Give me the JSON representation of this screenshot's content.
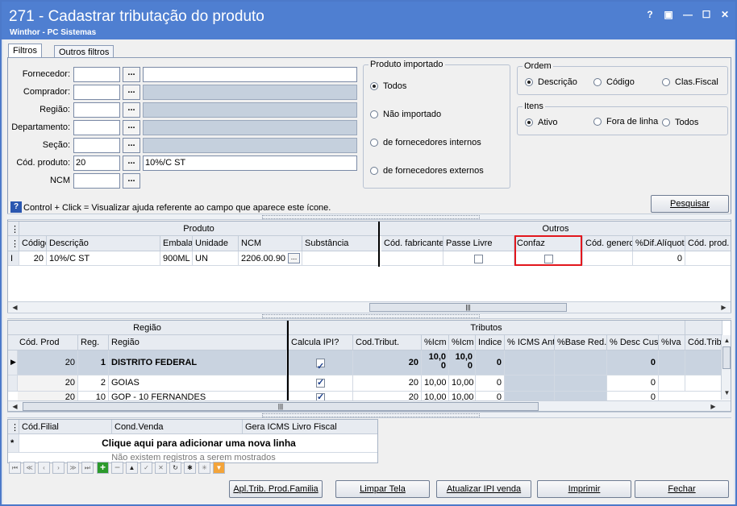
{
  "window": {
    "title": "271 - Cadastrar tributação do produto",
    "subtitle": "Winthor - PC Sistemas",
    "controls": [
      "?",
      "▣",
      "—",
      "☐",
      "✕"
    ]
  },
  "tabs": [
    {
      "label": "Filtros",
      "active": true
    },
    {
      "label": "Outros filtros",
      "active": false
    }
  ],
  "filters": {
    "fornecedor_label": "Fornecedor:",
    "comprador_label": "Comprador:",
    "regiao_label": "Região:",
    "departamento_label": "Departamento:",
    "secao_label": "Seção:",
    "cod_produto_label": "Cód. produto:",
    "cod_produto_value": "20",
    "cod_produto_desc": "10%/C ST",
    "ncm_label": "NCM",
    "dots": "..."
  },
  "produto_importado": {
    "title": "Produto importado",
    "options": [
      "Todos",
      "Não importado",
      "de fornecedores internos",
      "de fornecedores externos"
    ],
    "selected": 0
  },
  "ordem": {
    "title": "Ordem",
    "options": [
      "Descrição",
      "Código",
      "Clas.Fiscal"
    ],
    "selected": 0
  },
  "itens": {
    "title": "Itens",
    "options": [
      "Ativo",
      "Fora de linha",
      "Todos"
    ],
    "selected": 0
  },
  "help_text": "Control + Click = Visualizar ajuda referente ao campo que aparece este ícone.",
  "pesquisar_label": "Pesquisar",
  "grid1": {
    "group_produto": "Produto",
    "group_outros": "Outros",
    "columns": [
      "Código",
      "Descrição",
      "Embalag",
      "Unidade",
      "NCM",
      "Substância",
      "Cód. fabricante",
      "Passe Livre",
      "Confaz",
      "Cód. generc",
      "%Dif.Alíquot",
      "Cód. prod. n"
    ],
    "row": {
      "indicator": "I",
      "codigo": "20",
      "descricao": "10%/C ST",
      "embalagem": "900ML",
      "unidade": "UN",
      "ncm": "2206.00.90",
      "ncm_btn": "...",
      "dif_aliquota": "0"
    }
  },
  "grid2": {
    "group_regiao": "Região",
    "group_tributos": "Tributos",
    "columns": [
      "Cód. Prod",
      "Reg.",
      "Região",
      "Calcula IPI?",
      "Cod.Tribut.",
      "%Icm",
      "%Icm",
      "Indice",
      "% ICMS Ant",
      "%Base Red.",
      "% Desc Cus",
      "%Iva",
      "Cód.Trib"
    ],
    "rows": [
      {
        "cod": "20",
        "reg": "1",
        "regiao": "DISTRITO FEDERAL",
        "ipi": true,
        "trib": "20",
        "icm1": "10,0\n0",
        "icm2": "10,0\n0",
        "indice": "0",
        "desc": "0",
        "selected": true
      },
      {
        "cod": "20",
        "reg": "2",
        "regiao": "GOIAS",
        "ipi": true,
        "trib": "20",
        "icm1": "10,00",
        "icm2": "10,00",
        "indice": "0",
        "desc": "0",
        "selected": false
      },
      {
        "cod": "20",
        "reg": "10",
        "regiao": "GOP - 10 FERNANDES",
        "ipi": true,
        "trib": "20",
        "icm1": "10,00",
        "icm2": "10,00",
        "indice": "0",
        "desc": "0",
        "selected": false
      }
    ]
  },
  "grid3": {
    "columns": [
      "Cód.Filial",
      "Cond.Venda",
      "Gera ICMS Livro Fiscal"
    ],
    "new_row": "Clique aqui para adicionar uma nova linha",
    "empty": "Não existem registros a serem mostrados",
    "nav_icons": [
      "⏮",
      "≪",
      "‹",
      "›",
      "≫",
      "⏭",
      "+",
      "−",
      "▲",
      "✓",
      "✕",
      "↻",
      "✱",
      "✳",
      "▼"
    ]
  },
  "footer_buttons": {
    "familia": "Apl.Trib. Prod.Familia",
    "limpar": "Limpar Tela",
    "atualizar": "Atualizar IPI venda",
    "imprimir": "Imprimir",
    "fechar": "Fechar"
  }
}
